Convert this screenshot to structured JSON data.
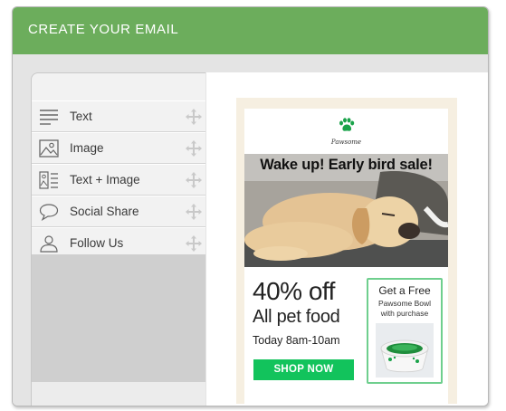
{
  "header": {
    "title": "CREATE YOUR EMAIL"
  },
  "sidebar": {
    "items": [
      {
        "label": "Text",
        "icon": "text-lines-icon"
      },
      {
        "label": "Image",
        "icon": "image-icon"
      },
      {
        "label": "Text + Image",
        "icon": "text-image-icon"
      },
      {
        "label": "Social Share",
        "icon": "speech-bubble-icon"
      },
      {
        "label": "Follow Us",
        "icon": "person-icon"
      }
    ]
  },
  "email": {
    "brand": "Pawsome",
    "headline": "Wake up! Early bird sale!",
    "promo": {
      "discount": "40% off",
      "subtitle": "All pet food",
      "time": "Today 8am-10am",
      "button": "SHOP NOW"
    },
    "offer": {
      "title": "Get a Free",
      "line1": "Pawsome Bowl",
      "line2": "with purchase"
    }
  },
  "colors": {
    "header": "#6cad5c",
    "button": "#12c35c",
    "offer_border": "#6fcf8e",
    "email_frame": "#f6efe1",
    "paw": "#1aa34a"
  }
}
